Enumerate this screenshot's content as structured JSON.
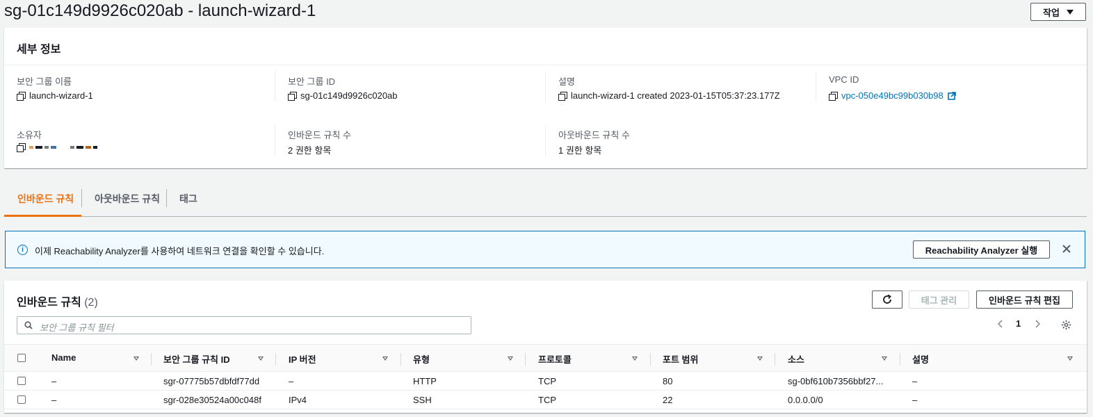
{
  "header": {
    "title": "sg-01c149d9926c020ab - launch-wizard-1",
    "actions_label": "작업"
  },
  "details": {
    "title": "세부 정보",
    "fields": {
      "sg_name": {
        "label": "보안 그룹 이름",
        "value": "launch-wizard-1"
      },
      "sg_id": {
        "label": "보안 그룹 ID",
        "value": "sg-01c149d9926c020ab"
      },
      "desc": {
        "label": "설명",
        "value": "launch-wizard-1 created 2023-01-15T05:37:23.177Z"
      },
      "vpc": {
        "label": "VPC ID",
        "value": "vpc-050e49bc99b030b98"
      },
      "owner": {
        "label": "소유자"
      },
      "inbound": {
        "label": "인바운드 규칙 수",
        "value": "2 권한 항목"
      },
      "outbound": {
        "label": "아웃바운드 규칙 수",
        "value": "1 권한 항목"
      }
    }
  },
  "tabs": [
    "인바운드 규칙",
    "아웃바운드 규칙",
    "태그"
  ],
  "banner": {
    "text": "이제 Reachability Analyzer를 사용하여 네트워크 연결을 확인할 수 있습니다.",
    "button": "Reachability Analyzer 실행"
  },
  "rules": {
    "title": "인바운드 규칙",
    "count": "(2)",
    "manage_tags": "태그 관리",
    "edit_rules": "인바운드 규칙 편집",
    "search_placeholder": "보안 그룹 규칙 필터",
    "page": "1",
    "columns": [
      "Name",
      "보안 그룹 규칙 ID",
      "IP 버전",
      "유형",
      "프로토콜",
      "포트 범위",
      "소스",
      "설명"
    ],
    "rows": [
      [
        "–",
        "sgr-07775b57dbfdf77dd",
        "–",
        "HTTP",
        "TCP",
        "80",
        "sg-0bf610b7356bbf27...",
        "–"
      ],
      [
        "–",
        "sgr-028e30524a00c048f",
        "IPv4",
        "SSH",
        "TCP",
        "22",
        "0.0.0.0/0",
        "–"
      ]
    ]
  },
  "colors": {
    "accent": "#ec7211",
    "link": "#0073bb",
    "info_bg": "#f1faff"
  }
}
